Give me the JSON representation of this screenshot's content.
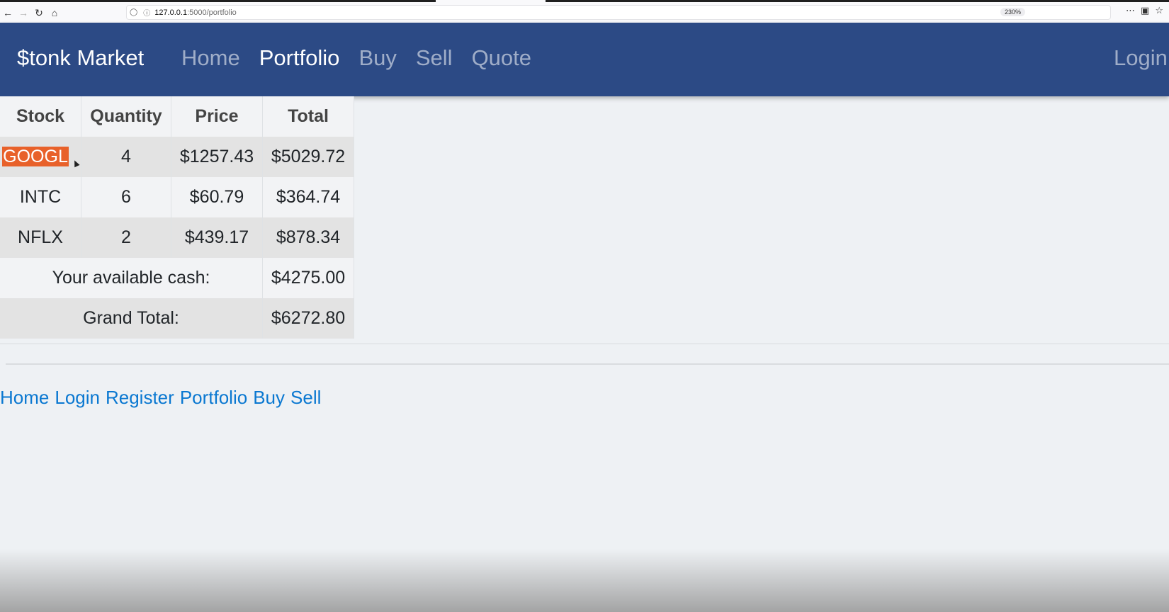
{
  "browser": {
    "url_host": "127.0.0.1",
    "url_path": ":5000/portfolio",
    "zoom": "230%"
  },
  "navbar": {
    "brand": "$tonk Market",
    "links": [
      "Home",
      "Portfolio",
      "Buy",
      "Sell",
      "Quote"
    ],
    "active": "Portfolio",
    "login": "Login"
  },
  "table": {
    "headers": [
      "Stock",
      "Quantity",
      "Price",
      "Total"
    ],
    "rows": [
      {
        "stock": "GOOGL",
        "quantity": "4",
        "price": "$1257.43",
        "total": "$5029.72"
      },
      {
        "stock": "INTC",
        "quantity": "6",
        "price": "$60.79",
        "total": "$364.74"
      },
      {
        "stock": "NFLX",
        "quantity": "2",
        "price": "$439.17",
        "total": "$878.34"
      }
    ],
    "cash_label": "Your available cash:",
    "cash_value": "$4275.00",
    "grand_label": "Grand Total:",
    "grand_value": "$6272.80"
  },
  "footer": {
    "links": [
      "Home",
      "Login",
      "Register",
      "Portfolio",
      "Buy",
      "Sell"
    ]
  },
  "colors": {
    "navbar": "#2c4a85",
    "highlight": "#e8612a",
    "link": "#0a78d1"
  }
}
